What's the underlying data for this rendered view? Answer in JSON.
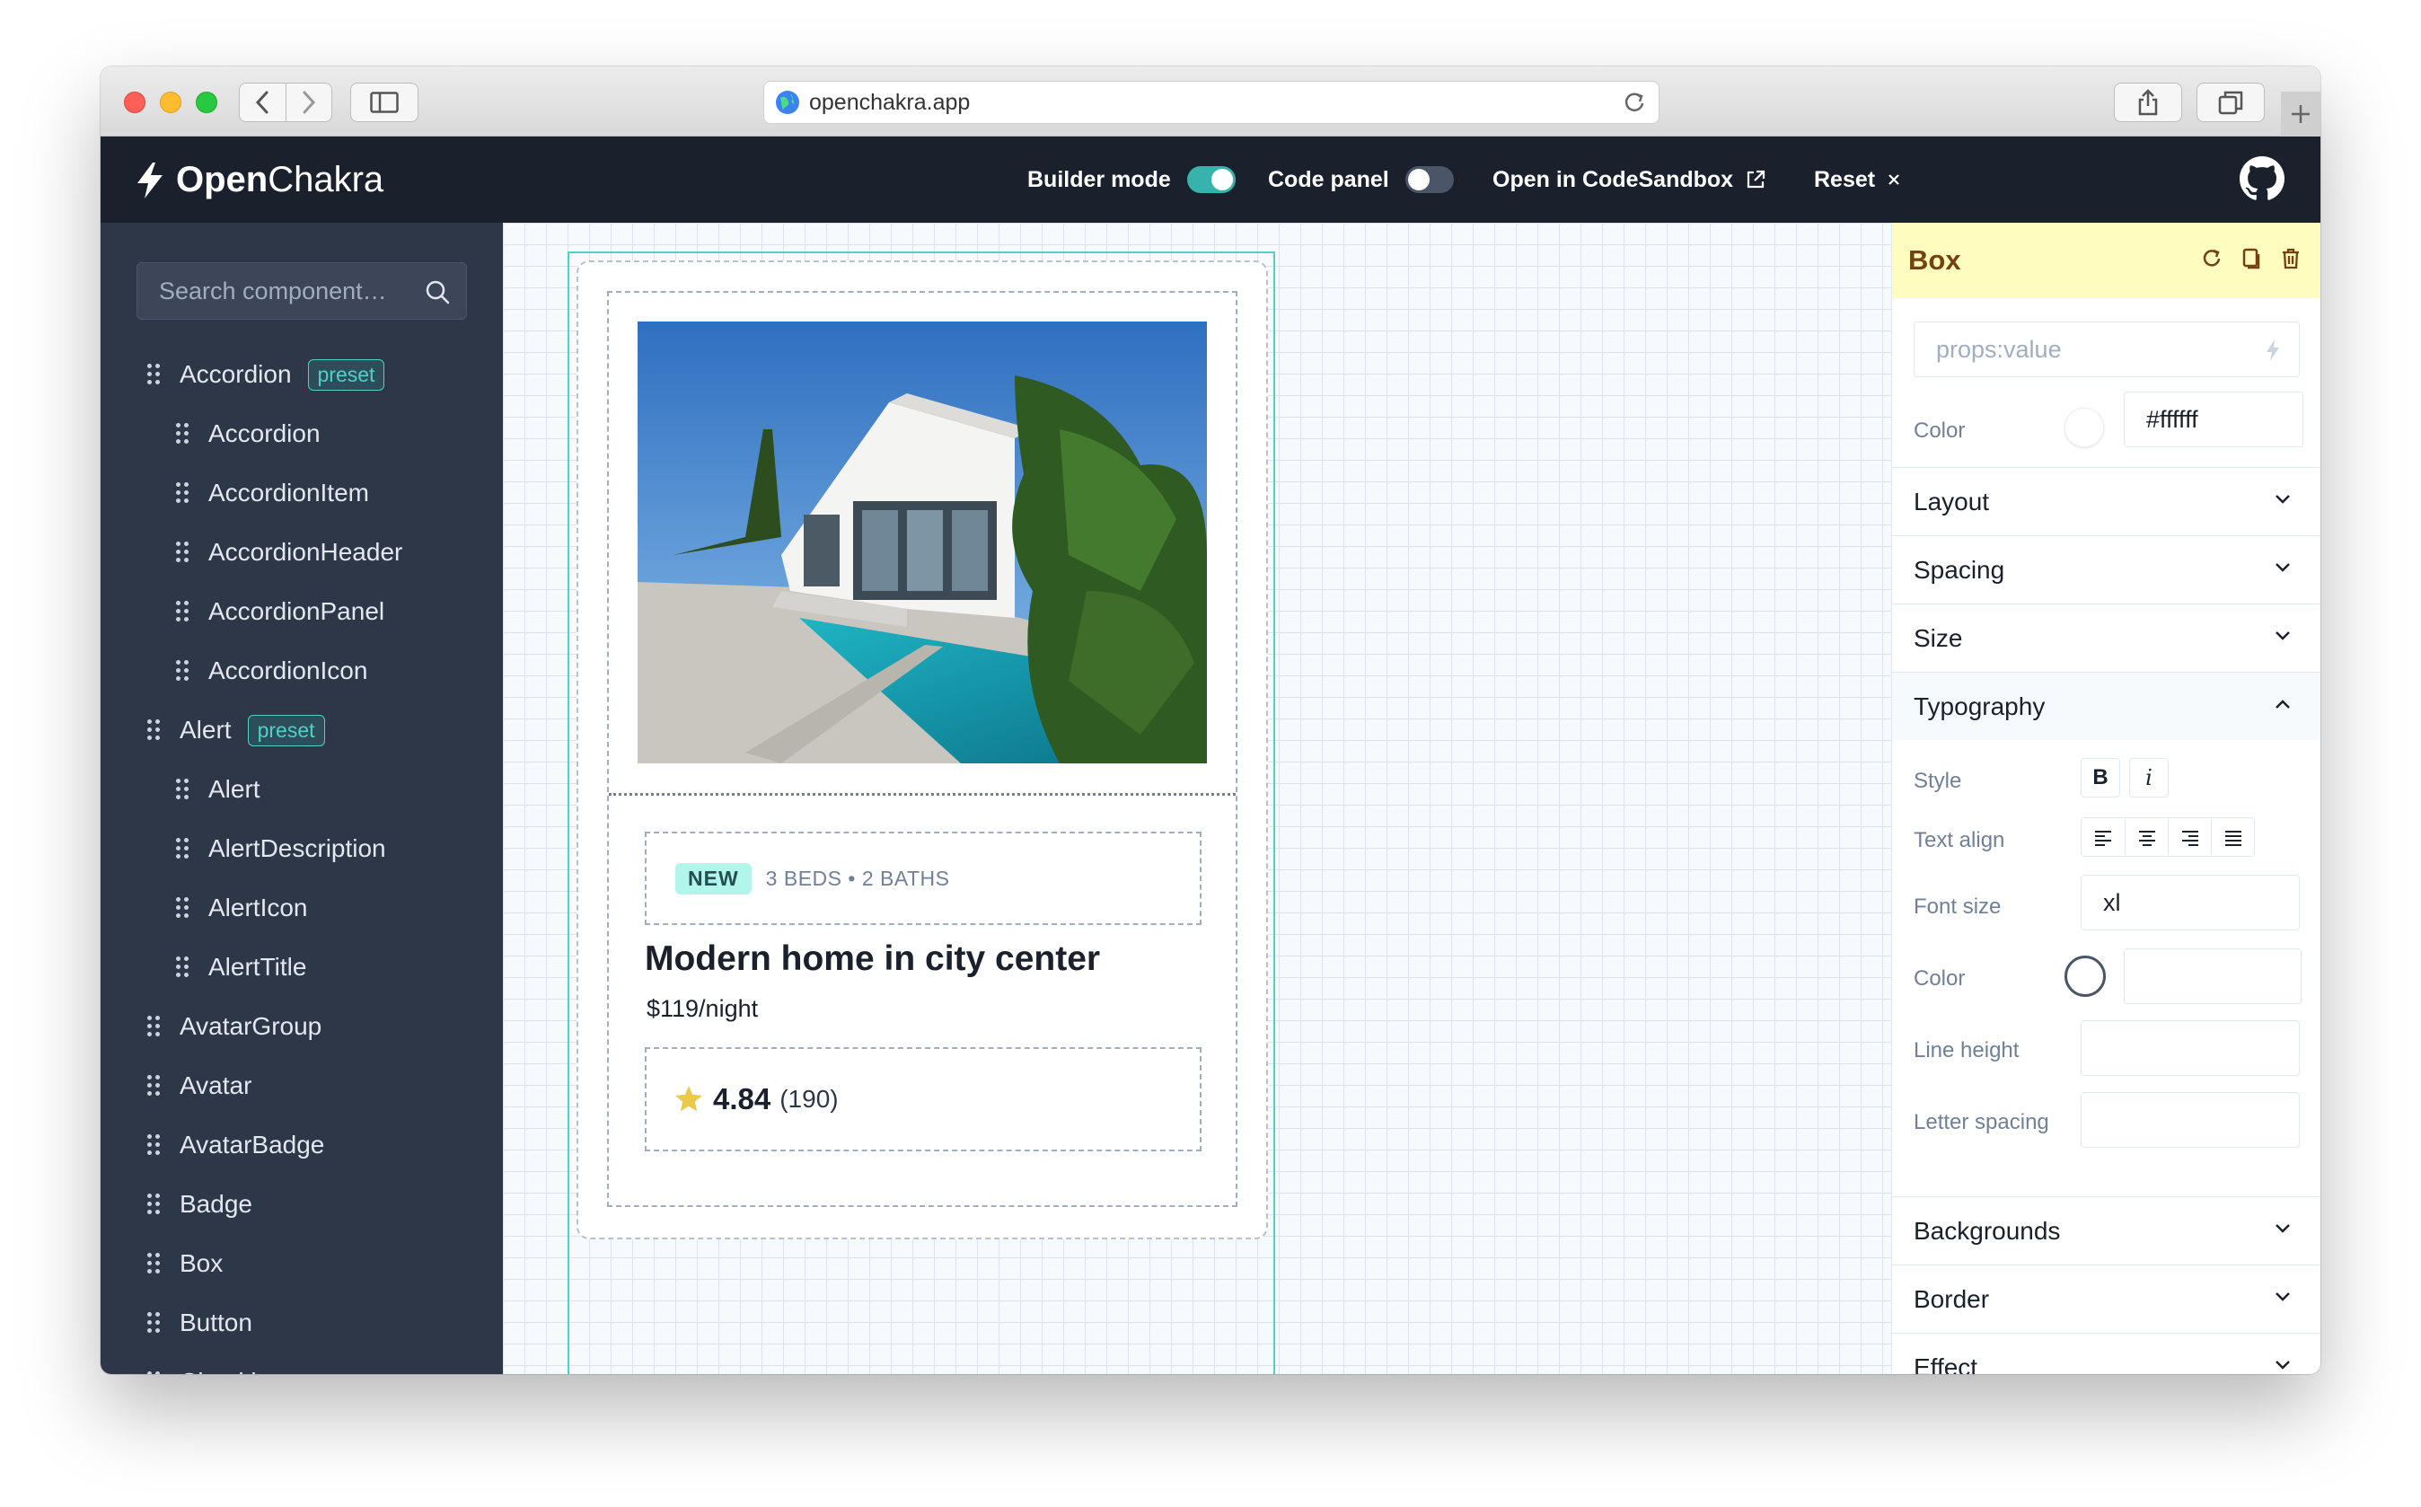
{
  "browser": {
    "url": "openchakra.app"
  },
  "header": {
    "logo_bold": "Open",
    "logo_rest": "Chakra",
    "builder_mode_label": "Builder mode",
    "builder_mode_on": true,
    "code_panel_label": "Code panel",
    "code_panel_on": false,
    "codesandbox_label": "Open in CodeSandbox",
    "reset_label": "Reset"
  },
  "sidebar": {
    "search_placeholder": "Search component…",
    "items": [
      {
        "label": "Accordion",
        "level": 0,
        "badge": "preset"
      },
      {
        "label": "Accordion",
        "level": 1
      },
      {
        "label": "AccordionItem",
        "level": 1
      },
      {
        "label": "AccordionHeader",
        "level": 1
      },
      {
        "label": "AccordionPanel",
        "level": 1
      },
      {
        "label": "AccordionIcon",
        "level": 1
      },
      {
        "label": "Alert",
        "level": 0,
        "badge": "preset"
      },
      {
        "label": "Alert",
        "level": 1
      },
      {
        "label": "AlertDescription",
        "level": 1
      },
      {
        "label": "AlertIcon",
        "level": 1
      },
      {
        "label": "AlertTitle",
        "level": 1
      },
      {
        "label": "AvatarGroup",
        "level": 0
      },
      {
        "label": "Avatar",
        "level": 0
      },
      {
        "label": "AvatarBadge",
        "level": 0
      },
      {
        "label": "Badge",
        "level": 0
      },
      {
        "label": "Box",
        "level": 0
      },
      {
        "label": "Button",
        "level": 0
      },
      {
        "label": "Checkbox",
        "level": 0
      }
    ]
  },
  "card": {
    "badge": "NEW",
    "meta": "3 BEDS • 2 BATHS",
    "title": "Modern home in city center",
    "price": "$119/night",
    "rating": "4.84",
    "reviews": "(190)"
  },
  "inspector": {
    "title": "Box",
    "props_placeholder": "props:value",
    "color_label": "Color",
    "color_value": "#ffffff",
    "sections": {
      "layout": "Layout",
      "spacing": "Spacing",
      "size": "Size",
      "typography": "Typography",
      "backgrounds": "Backgrounds",
      "border": "Border",
      "effect": "Effect"
    },
    "typography": {
      "style_label": "Style",
      "bold_label": "B",
      "italic_label": "i",
      "text_align_label": "Text align",
      "font_size_label": "Font size",
      "font_size_value": "xl",
      "color_label": "Color",
      "line_height_label": "Line height",
      "letter_spacing_label": "Letter spacing"
    }
  },
  "colors": {
    "header_bg": "#1a202c",
    "sidebar_bg": "#2d3748",
    "accent_teal": "#38b2ac",
    "inspector_head_bg": "#fefcbf"
  }
}
